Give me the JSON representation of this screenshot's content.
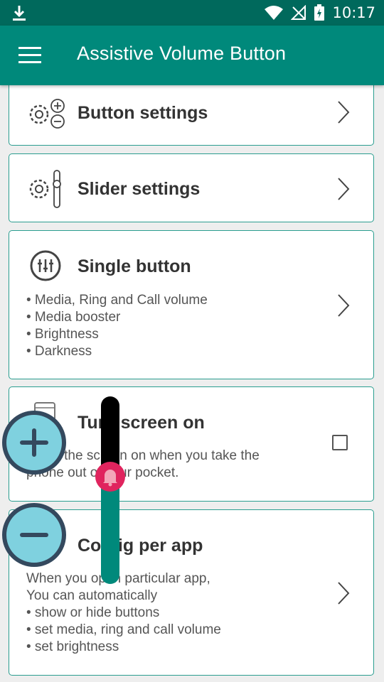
{
  "status_bar": {
    "time": "10:17"
  },
  "app_bar": {
    "title": "Assistive Volume Button",
    "menu_icon": "hamburger-menu-icon"
  },
  "cards": {
    "button_settings": {
      "title": "Button settings"
    },
    "slider_settings": {
      "title": "Slider settings"
    },
    "single_button": {
      "title": "Single button",
      "bullets": [
        "• Media, Ring and Call volume",
        "• Media booster",
        "• Brightness",
        "• Darkness"
      ]
    },
    "turn_screen_on": {
      "title": "Turn screen on",
      "desc_lines": [
        "Turns the screen on when you take the",
        "phone out of your pocket."
      ],
      "checked": false
    },
    "config_per_app": {
      "title": "Config per app",
      "desc_lines": [
        "When you open particular app,",
        "You can automatically",
        "• show or hide buttons",
        "• set media, ring and call volume",
        "• set brightness"
      ]
    }
  },
  "floating": {
    "plus_label": "+",
    "minus_label": "−",
    "slider_level": 0.6,
    "colors": {
      "button_fill": "#7fd1df",
      "button_ring": "#34495e",
      "slider_fill": "#00897b",
      "slider_track": "#000000",
      "thumb": "#e0245e"
    }
  },
  "colors": {
    "app_bar": "#00897b",
    "status_bar": "#00695c",
    "card_border": "#2a9d8f"
  }
}
